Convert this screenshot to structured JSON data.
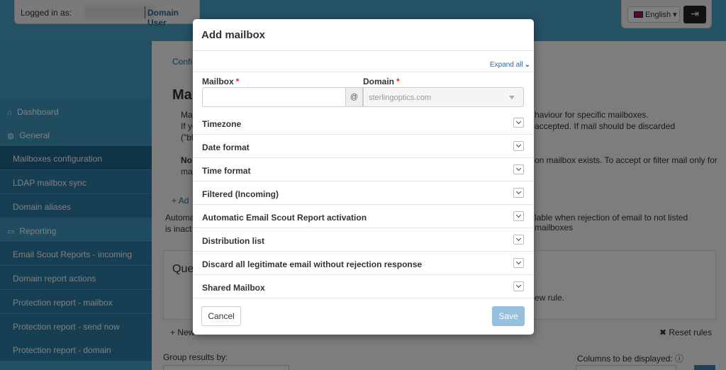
{
  "header": {
    "logged_in_label": "Logged in as:",
    "domain_user": "Domain User",
    "language": "English",
    "logout_icon": "logout-icon"
  },
  "sidebar": {
    "items": [
      {
        "label": "Dashboard",
        "icon": "home-icon"
      },
      {
        "label": "General",
        "icon": "globe-icon"
      },
      {
        "label": "Mailboxes configuration"
      },
      {
        "label": "LDAP mailbox sync"
      },
      {
        "label": "Domain aliases"
      },
      {
        "label": "Reporting",
        "icon": "report-icon"
      },
      {
        "label": "Email Scout Reports - incoming"
      },
      {
        "label": "Domain report actions"
      },
      {
        "label": "Protection report - mailbox"
      },
      {
        "label": "Protection report - send now"
      },
      {
        "label": "Protection report - domain"
      }
    ]
  },
  "background": {
    "crumb": "Confi",
    "page_title": "Ma",
    "note_l1": "Ma",
    "note_l2": "If yo",
    "note_l3": "(\"bl",
    "note_l4": "No",
    "note_l5": "ma",
    "note_r1": "haviour for specific mailboxes.",
    "note_r2": "accepted. If mail should be discarded",
    "note_r3": "on mailbox exists. To accept or filter mail only for",
    "add_label": "Ad",
    "auto_l1": "Automa",
    "auto_l2": "is inact",
    "auto_r1": "lable when rejection of email to not listed mailboxes",
    "panel_title": "Que",
    "panel_text": "ew rule.",
    "new_label": "New",
    "reset_rules": "Reset rules",
    "group_results": "Group results by:",
    "columns_displayed": "Columns to be displayed:"
  },
  "modal": {
    "title": "Add mailbox",
    "expand_all": "Expand all",
    "mailbox_label": "Mailbox",
    "domain_label": "Domain",
    "required_mark": "*",
    "mailbox_value": "",
    "at_symbol": "@",
    "domain_value": "sterlingoptics.com",
    "sections": [
      "Timezone",
      "Date format",
      "Time format",
      "Filtered (Incoming)",
      "Automatic Email Scout Report activation",
      "Distribution list",
      "Discard all legitimate email without rejection response",
      "Shared Mailbox"
    ],
    "cancel_label": "Cancel",
    "save_label": "Save"
  },
  "colors": {
    "topbar": "#4aa3c8",
    "sidebar": "#43a0c6",
    "sidebar_active": "#1f6890",
    "save_button": "#97bfde",
    "link": "#2a6aa8",
    "required": "#c9302c"
  }
}
